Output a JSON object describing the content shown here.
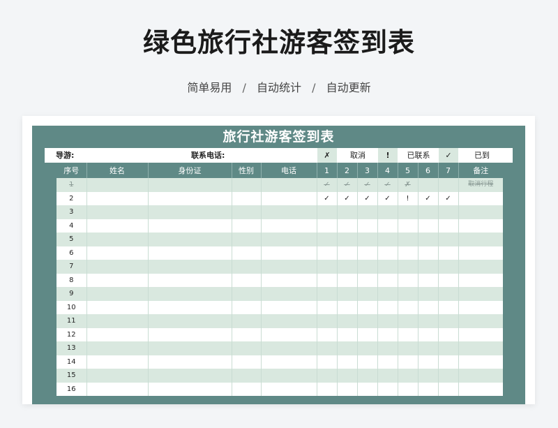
{
  "header": {
    "title": "绿色旅行社游客签到表",
    "subtitle_items": [
      "简单易用",
      "自动统计",
      "自动更新"
    ],
    "subtitle_separator": "/"
  },
  "sheet": {
    "title": "旅行社游客签到表",
    "guide_label": "导游:",
    "phone_label": "联系电话:",
    "legend": [
      {
        "symbol": "✗",
        "text": "取消"
      },
      {
        "symbol": "!",
        "text": "已联系"
      },
      {
        "symbol": "✓",
        "text": "已到"
      }
    ],
    "columns": [
      "序号",
      "姓名",
      "身份证",
      "性别",
      "电话",
      "1",
      "2",
      "3",
      "4",
      "5",
      "6",
      "7",
      "备注"
    ],
    "rows": [
      {
        "no": "1",
        "marks": [
          "✓",
          "✓",
          "✓",
          "✓",
          "✗",
          "",
          ""
        ],
        "remark": "取消行程",
        "cancelled": true
      },
      {
        "no": "2",
        "marks": [
          "✓",
          "✓",
          "✓",
          "✓",
          "!",
          "✓",
          "✓"
        ],
        "remark": "",
        "cancelled": false
      },
      {
        "no": "3",
        "marks": [
          "",
          "",
          "",
          "",
          "",
          "",
          ""
        ],
        "remark": "",
        "cancelled": false
      },
      {
        "no": "4",
        "marks": [
          "",
          "",
          "",
          "",
          "",
          "",
          ""
        ],
        "remark": "",
        "cancelled": false
      },
      {
        "no": "5",
        "marks": [
          "",
          "",
          "",
          "",
          "",
          "",
          ""
        ],
        "remark": "",
        "cancelled": false
      },
      {
        "no": "6",
        "marks": [
          "",
          "",
          "",
          "",
          "",
          "",
          ""
        ],
        "remark": "",
        "cancelled": false
      },
      {
        "no": "7",
        "marks": [
          "",
          "",
          "",
          "",
          "",
          "",
          ""
        ],
        "remark": "",
        "cancelled": false
      },
      {
        "no": "8",
        "marks": [
          "",
          "",
          "",
          "",
          "",
          "",
          ""
        ],
        "remark": "",
        "cancelled": false
      },
      {
        "no": "9",
        "marks": [
          "",
          "",
          "",
          "",
          "",
          "",
          ""
        ],
        "remark": "",
        "cancelled": false
      },
      {
        "no": "10",
        "marks": [
          "",
          "",
          "",
          "",
          "",
          "",
          ""
        ],
        "remark": "",
        "cancelled": false
      },
      {
        "no": "11",
        "marks": [
          "",
          "",
          "",
          "",
          "",
          "",
          ""
        ],
        "remark": "",
        "cancelled": false
      },
      {
        "no": "12",
        "marks": [
          "",
          "",
          "",
          "",
          "",
          "",
          ""
        ],
        "remark": "",
        "cancelled": false
      },
      {
        "no": "13",
        "marks": [
          "",
          "",
          "",
          "",
          "",
          "",
          ""
        ],
        "remark": "",
        "cancelled": false
      },
      {
        "no": "14",
        "marks": [
          "",
          "",
          "",
          "",
          "",
          "",
          ""
        ],
        "remark": "",
        "cancelled": false
      },
      {
        "no": "15",
        "marks": [
          "",
          "",
          "",
          "",
          "",
          "",
          ""
        ],
        "remark": "",
        "cancelled": false
      },
      {
        "no": "16",
        "marks": [
          "",
          "",
          "",
          "",
          "",
          "",
          ""
        ],
        "remark": "",
        "cancelled": false
      }
    ]
  },
  "colors": {
    "accent": "#5f8986",
    "stripe": "#d9e8df",
    "background": "#f3f5f7"
  }
}
